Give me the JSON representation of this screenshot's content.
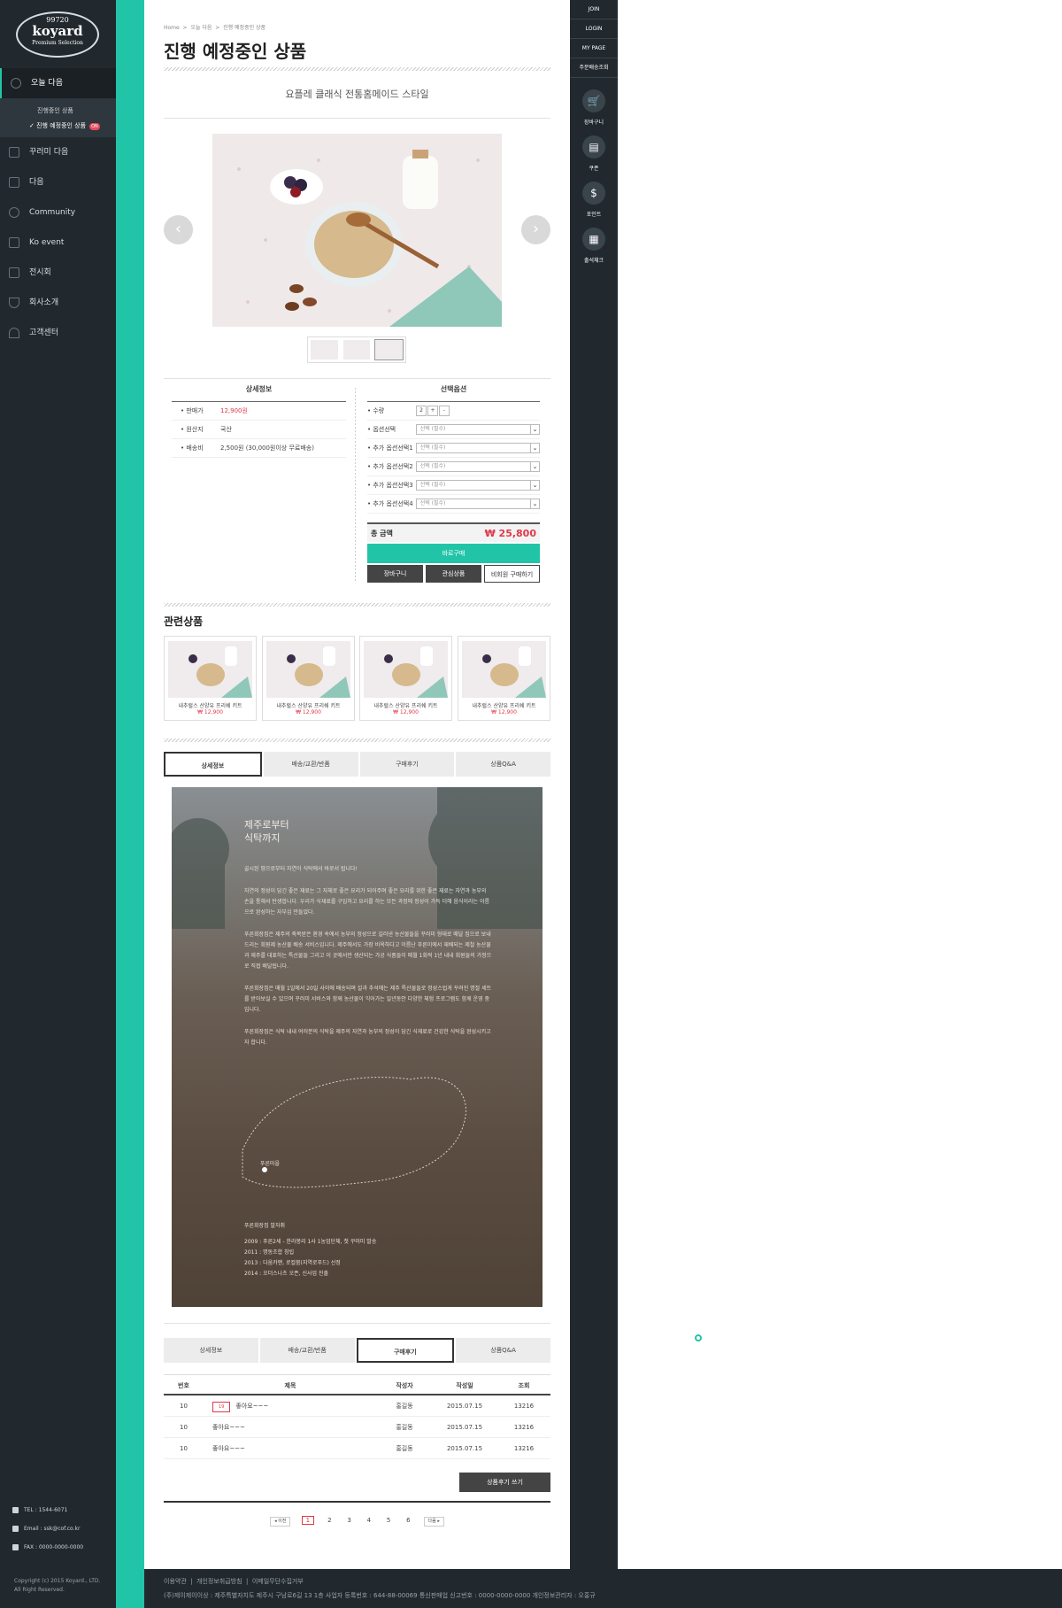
{
  "logo": {
    "number": "99720",
    "brand": "koyard",
    "tagline": "Premium Selection"
  },
  "sidebar": {
    "items": [
      {
        "label": "오늘 다음",
        "icon": "alarm-icon",
        "active": true
      },
      {
        "label": "꾸러미 다음",
        "icon": "building-icon"
      },
      {
        "label": "다음",
        "icon": "bag-icon"
      },
      {
        "label": "Community",
        "icon": "chat-icon"
      },
      {
        "label": "Ko event",
        "icon": "gift-icon"
      },
      {
        "label": "전시회",
        "icon": "monitor-icon"
      },
      {
        "label": "회사소개",
        "icon": "trophy-icon"
      },
      {
        "label": "고객센터",
        "icon": "person-icon"
      }
    ],
    "sub_items": [
      "진행중인 상품",
      "진행 예정중인 상품"
    ],
    "on_badge": "ON",
    "contact": {
      "tel": "TEL : 1544-6071",
      "email": "Email : ssk@cof.co.kr",
      "fax": "FAX : 0000-0000-0000"
    },
    "copyright": [
      "Copyright (c) 2015 Koyard., LTD.",
      "All Right Reserved."
    ]
  },
  "right_bar": {
    "top": [
      "JOIN",
      "LOGIN",
      "MY PAGE",
      "주문배송조회"
    ],
    "quick": [
      {
        "label": "장바구니",
        "icon": "cart-icon",
        "glyph": "🛒"
      },
      {
        "label": "쿠폰",
        "icon": "coupon-icon",
        "glyph": "▤"
      },
      {
        "label": "포인트",
        "icon": "dollar-icon",
        "glyph": "$"
      },
      {
        "label": "출석체크",
        "icon": "calendar-icon",
        "glyph": "▦"
      }
    ]
  },
  "breadcrumb": [
    "Home",
    ">",
    "오늘 다음",
    ">",
    "진행 예정중인 상품"
  ],
  "page_title": "진행 예정중인 상품",
  "product_subtitle": "요플레 클래식 전통홈메이드 스타일",
  "detail_info": {
    "title": "상세정보",
    "rows": [
      {
        "key": "판매가",
        "value": "12,900원"
      },
      {
        "key": "원산지",
        "value": "국산"
      },
      {
        "key": "배송비",
        "value": "2,500원 (30,000원이상 무료배송)"
      }
    ]
  },
  "options": {
    "title": "선택옵션",
    "qty_label": "수량",
    "qty": "2",
    "plus": "+",
    "minus": "-",
    "rows": [
      {
        "key": "옵션선택",
        "value": "선택 (필수)"
      },
      {
        "key": "추가 옵션선택1",
        "value": "선택 (필수)"
      },
      {
        "key": "추가 옵션선택2",
        "value": "선택 (필수)"
      },
      {
        "key": "추가 옵션선택3",
        "value": "선택 (필수)"
      },
      {
        "key": "추가 옵션선택4",
        "value": "선택 (필수)"
      }
    ],
    "caret": "⌄"
  },
  "total": {
    "label": "총 금액",
    "amount": "₩ 25,800"
  },
  "buttons": {
    "buy": "바로구매",
    "cart": "장바구니",
    "wish": "관심상품",
    "guest": "비회원 구매하기"
  },
  "related": {
    "title": "관련상품",
    "items": [
      {
        "name": "내추럴스 산양유 프리쉐 키트",
        "price": "₩ 12,900"
      },
      {
        "name": "내추럴스 산양유 프리쉐 키트",
        "price": "₩ 12,900"
      },
      {
        "name": "내추럴스 산양유 프리쉐 키트",
        "price": "₩ 12,900"
      },
      {
        "name": "내추럴스 산양유 프리쉐 키트",
        "price": "₩ 12,900"
      }
    ]
  },
  "tabs": [
    "상세정보",
    "배송/교환/반품",
    "구매후기",
    "상품Q&A"
  ],
  "detail_content": {
    "title": [
      "제주로부터",
      "식탁까지"
    ],
    "paras": [
      "골시된 땅으로부터 자연이 식탁에서 바로서 됩니다!",
      "자연의 정성이 담긴 좋은 재료는 그 자체로 좋은 요리가 되어주며 좋은 요리를 위한 좋은 재료는 자연과 농부의 손을 통해서 탄생합니다. 우리가 식재료를 구입하고 요리를 하는 모든 과정에 정성이 가득 더해 음식이라는 이름으로 완성하는 자부심 만들었다.",
      "푸른회장집은 제주의 축복받은 환경 속에서 농부의 정성으로 길러낸 농산물들을 꾸러미 형태로 매달 집으로 보내드리는 회원제 농산물 배송 서비스입니다. 제주에서도 가장 비옥하다고 이름난 푸른이에서 재배되는 제철 농산물과 제주를 대표하는 특산물들 그리고 이 곳에서만 생산되는 가공 식품들이 매월 1회씩 1년 내내 회원들의 가정으로 직접 배달됩니다.",
      "푸른회장집은 매월 1일에서 20일 사이에 배송되며 설과 추석에는 제주 특산물들로 정성스럽게 꾸려진 명절 세트를 받아보실 수 있으며 꾸러미 서비스와 함께 농산물이 익어가는 일년동안 다양한 체험 프로그램도 함께 운영 중입니다.",
      "푸른회장집은 식탁 내내 여러분의 식탁을 제주의 자연과 농부의 정성이 담긴 식재료로 건강한 식탁을 완성시키고자 합니다."
    ],
    "map_label": "푸른마을",
    "history_title": "푸른회장집 발자취",
    "history": [
      "2009 : 푸른2세 - 한라봉리 1사 1농업단체, 첫 꾸러미 발송",
      "2011 : 명동조합 창립",
      "2013 : 다움카맨, 로컬붐(지역로푸드) 선정",
      "2014 : 오더스나츠 오픈, 신사업 진출"
    ]
  },
  "review": {
    "headers": [
      "번호",
      "제목",
      "작성자",
      "작성일",
      "조회"
    ],
    "rows": [
      {
        "no": "10",
        "tag": "19",
        "title": "좋아요~~~",
        "writer": "홍길동",
        "date": "2015.07.15",
        "views": "13216"
      },
      {
        "no": "10",
        "tag": "",
        "title": "좋아요~~~",
        "writer": "홍길동",
        "date": "2015.07.15",
        "views": "13216"
      },
      {
        "no": "10",
        "tag": "",
        "title": "좋아요~~~",
        "writer": "홍길동",
        "date": "2015.07.15",
        "views": "13216"
      }
    ],
    "write_button": "상품후기 쓰기"
  },
  "pager": {
    "prev": "◂ 이전",
    "pages": [
      "1",
      "2",
      "3",
      "4",
      "5",
      "6"
    ],
    "next": "다음 ▸",
    "current": "1"
  },
  "footer": {
    "links": [
      "이용약관",
      "개인정보취급방침",
      "이메일무단수집거부"
    ],
    "address": "(주)제이제이이상 : 제주특별자치도 제주시 구남로6길 13 1층   사업자 등록번호 : 644-88-00069   통신판매업 신고번호 : 0000-0000-0000   개인정보관리자 : 오홍규"
  },
  "colors": {
    "accent": "#22c4a8",
    "sidebar": "#22292e",
    "price": "#e0384a"
  }
}
